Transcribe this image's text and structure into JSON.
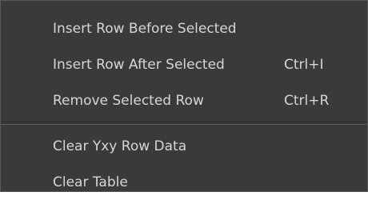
{
  "context_menu": {
    "items": [
      {
        "label": "Insert Row Before Selected",
        "shortcut": ""
      },
      {
        "label": "Insert Row After Selected",
        "shortcut": "Ctrl+I"
      },
      {
        "label": "Remove Selected Row",
        "shortcut": "Ctrl+R"
      },
      {
        "label": "Clear Yxy Row Data",
        "shortcut": ""
      },
      {
        "label": "Clear Table",
        "shortcut": ""
      }
    ]
  },
  "colors": {
    "menu_background": "#3a3a3a",
    "text": "#d6d6d6",
    "border": "#5a5a5a"
  }
}
